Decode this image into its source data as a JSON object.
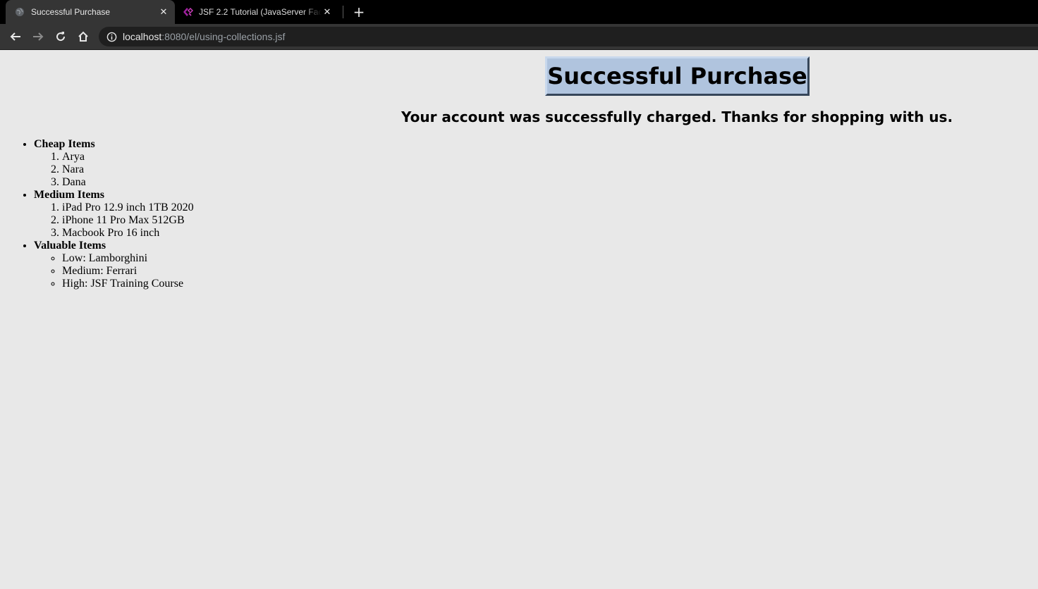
{
  "browser": {
    "tabs": [
      {
        "title": "Successful Purchase",
        "active": true,
        "favicon": "globe-icon"
      },
      {
        "title": "JSF 2.2 Tutorial (JavaServer Faces",
        "active": false,
        "favicon": "coreservlets-logo-icon"
      }
    ],
    "url_host": "localhost",
    "url_rest": ":8080/el/using-collections.jsf"
  },
  "page": {
    "heading": "Successful Purchase",
    "message": "Your account was successfully charged. Thanks for shopping with us.",
    "groups": [
      {
        "label": "Cheap Items",
        "list_style": "ordered",
        "items": [
          "Arya",
          "Nara",
          "Dana"
        ]
      },
      {
        "label": "Medium Items",
        "list_style": "ordered",
        "items": [
          "iPad Pro 12.9 inch 1TB 2020",
          "iPhone 11 Pro Max 512GB",
          "Macbook Pro 16 inch"
        ]
      },
      {
        "label": "Valuable Items",
        "list_style": "bulleted",
        "items": [
          "Low: Lamborghini",
          "Medium: Ferrari",
          "High: JSF Training Course"
        ]
      }
    ]
  },
  "colors": {
    "page_background": "#e8e8e8",
    "heading_box": "#b0c4de",
    "chrome_dark": "#353535"
  }
}
